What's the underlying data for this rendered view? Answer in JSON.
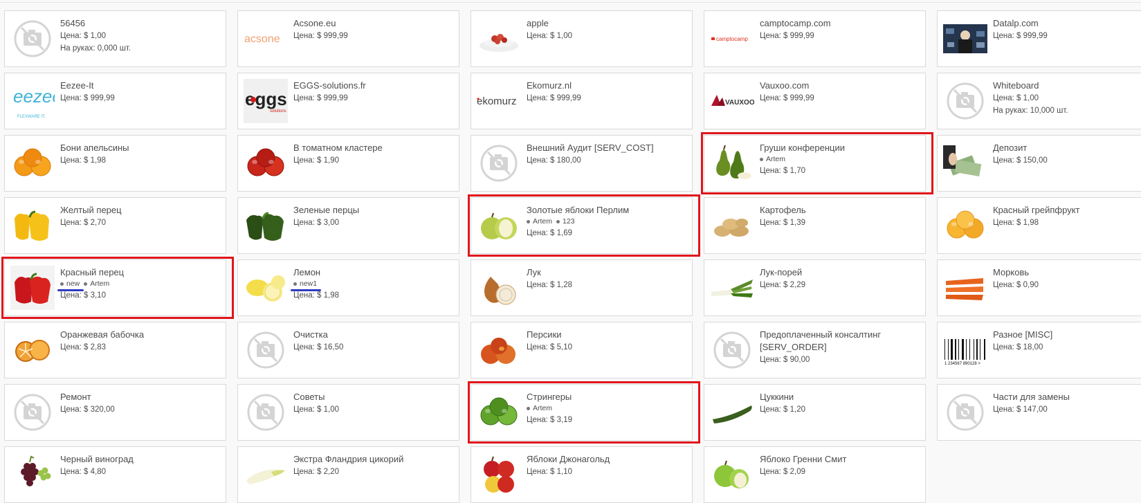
{
  "price_prefix": "Цена: ",
  "onhand_prefix": "На руках: ",
  "highlight_color": "#e0151b",
  "tag_underline_color": "#2f3bbf",
  "products": [
    {
      "name": "56456",
      "price": "$ 1,00",
      "onhand": "0,000 шт.",
      "icon": "no-image-icon"
    },
    {
      "name": "Acsone.eu",
      "price": "$ 999,99",
      "icon": "acsone-logo"
    },
    {
      "name": "apple",
      "price": "$ 1,00",
      "icon": "apple-dessert-image"
    },
    {
      "name": "camptocamp.com",
      "price": "$ 999,99",
      "icon": "camptocamp-logo"
    },
    {
      "name": "Datalp.com",
      "price": "$ 999,99",
      "icon": "datalp-logo"
    },
    {
      "name": "Eezee-It",
      "price": "$ 999,99",
      "icon": "eezee-it-logo"
    },
    {
      "name": "EGGS-solutions.fr",
      "price": "$ 999,99",
      "icon": "eggs-logo"
    },
    {
      "name": "Ekomurz.nl",
      "price": "$ 999,99",
      "icon": "ekomurz-logo"
    },
    {
      "name": "Vauxoo.com",
      "price": "$ 999,99",
      "icon": "vauxoo-logo"
    },
    {
      "name": "Whiteboard",
      "price": "$ 1,00",
      "onhand": "10,000 шт.",
      "icon": "no-image-icon"
    },
    {
      "name": "Бони апельсины",
      "price": "$ 1,98",
      "icon": "oranges-image"
    },
    {
      "name": "В томатном кластере",
      "price": "$ 1,90",
      "icon": "tomatoes-image"
    },
    {
      "name": "Внешний Аудит [SERV_COST]",
      "price": "$ 180,00",
      "icon": "no-image-icon"
    },
    {
      "name": "Груши конференции",
      "price": "$ 1,70",
      "tags": [
        "Artem"
      ],
      "icon": "pears-image",
      "highlighted": true
    },
    {
      "name": "Депозит",
      "price": "$ 150,00",
      "icon": "money-image"
    },
    {
      "name": "Желтый перец",
      "price": "$ 2,70",
      "icon": "yellow-pepper-image"
    },
    {
      "name": "Зеленые перцы",
      "price": "$ 3,00",
      "icon": "green-pepper-image"
    },
    {
      "name": "Золотые яблоки Перлим",
      "price": "$ 1,69",
      "tags": [
        "Artem",
        "123"
      ],
      "icon": "green-apples-image",
      "highlighted": true
    },
    {
      "name": "Картофель",
      "price": "$ 1,39",
      "icon": "potatoes-image"
    },
    {
      "name": "Красный грейпфрукт",
      "price": "$ 1,98",
      "icon": "grapefruit-image"
    },
    {
      "name": "Красный перец",
      "price": "$ 3,10",
      "tags": [
        "new",
        "Artem"
      ],
      "underline_tags": [
        "new"
      ],
      "icon": "red-pepper-image",
      "highlighted": true
    },
    {
      "name": "Лемон",
      "price": "$ 1,98",
      "tags": [
        "new1"
      ],
      "underline_tags": [
        "new1"
      ],
      "icon": "lemon-image"
    },
    {
      "name": "Лук",
      "price": "$ 1,28",
      "icon": "onion-image"
    },
    {
      "name": "Лук-порей",
      "price": "$ 2,29",
      "icon": "leek-image"
    },
    {
      "name": "Морковь",
      "price": "$ 0,90",
      "icon": "carrots-image"
    },
    {
      "name": "Оранжевая бабочка",
      "price": "$ 2,83",
      "icon": "orange-slices-image"
    },
    {
      "name": "Очистка",
      "price": "$ 16,50",
      "icon": "no-image-icon"
    },
    {
      "name": "Персики",
      "price": "$ 5,10",
      "icon": "peaches-image"
    },
    {
      "name": "Предоплаченный консалтинг [SERV_ORDER]",
      "price": "$ 90,00",
      "icon": "no-image-icon"
    },
    {
      "name": "Разное [MISC]",
      "price": "$ 18,00",
      "icon": "barcode-image"
    },
    {
      "name": "Ремонт",
      "price": "$ 320,00",
      "icon": "no-image-icon"
    },
    {
      "name": "Советы",
      "price": "$ 1,00",
      "icon": "no-image-icon"
    },
    {
      "name": "Стрингеры",
      "price": "$ 3,19",
      "tags": [
        "Artem"
      ],
      "icon": "limes-image",
      "highlighted": true
    },
    {
      "name": "Цуккини",
      "price": "$ 1,20",
      "icon": "zucchini-image"
    },
    {
      "name": "Части для замены",
      "price": "$ 147,00",
      "icon": "no-image-icon"
    },
    {
      "name": "Черный виноград",
      "price": "$ 4,80",
      "icon": "grapes-image"
    },
    {
      "name": "Экстра Фландрия цикорий",
      "price": "$ 2,20",
      "icon": "chicory-image"
    },
    {
      "name": "Яблоки Джонагольд",
      "price": "$ 1,10",
      "icon": "red-apples-image"
    },
    {
      "name": "Яблоко Гренни Смит",
      "price": "$ 2,09",
      "icon": "granny-smith-image"
    }
  ],
  "logos": {
    "acsone": "acsone",
    "camptocamp": "camptocamp",
    "eezee_top": "eezee",
    "eezee_bottom": "FLEXWARE IT.",
    "eggs": "eggs",
    "eggs_sub": "solutions",
    "ekomurz": "ekomurz",
    "vauxoo": "VAUXOO",
    "barcode": "1 234567 890128 >"
  }
}
